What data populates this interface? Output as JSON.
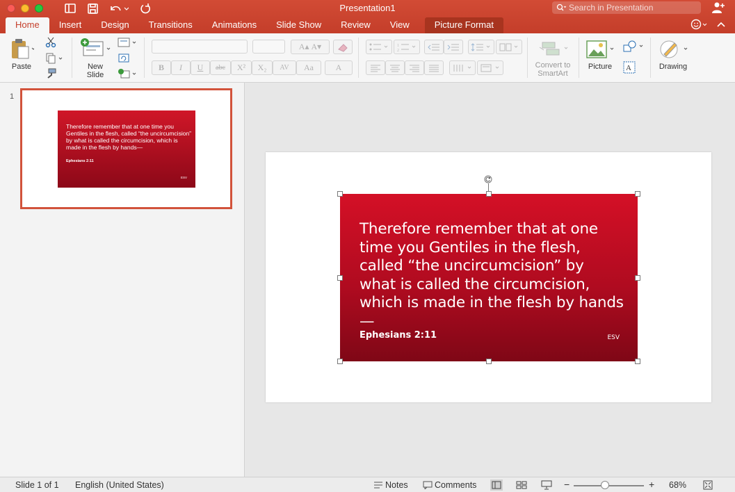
{
  "window": {
    "title": "Presentation1"
  },
  "search": {
    "placeholder": "Search in Presentation"
  },
  "tabs": [
    {
      "label": "Home"
    },
    {
      "label": "Insert"
    },
    {
      "label": "Design"
    },
    {
      "label": "Transitions"
    },
    {
      "label": "Animations"
    },
    {
      "label": "Slide Show"
    },
    {
      "label": "Review"
    },
    {
      "label": "View"
    },
    {
      "label": "Picture Format"
    }
  ],
  "ribbon": {
    "paste_label": "Paste",
    "new_slide_label_line1": "New",
    "new_slide_label_line2": "Slide",
    "convert_label_line1": "Convert to",
    "convert_label_line2": "SmartArt",
    "picture_label": "Picture",
    "drawing_label": "Drawing",
    "fmt": {
      "bold": "B",
      "italic": "I",
      "underline": "U",
      "strike": "abc",
      "superscript": "X²",
      "subscript": "X₂",
      "spacing": "AV",
      "case": "Aa",
      "fontcolor": "A",
      "grow": "A▴",
      "shrink": "A▾"
    }
  },
  "thumbnail": {
    "slide_number": "1"
  },
  "slide_content": {
    "quote": "Therefore remember that at one time you Gentiles in the flesh, called “the uncircumcision” by what is called the circumcision, which is made in the flesh by hands—",
    "reference": "Ephesians 2:11",
    "version": "ESV"
  },
  "status": {
    "slide_info": "Slide 1 of 1",
    "language": "English (United States)",
    "notes": "Notes",
    "comments": "Comments",
    "zoom_minus": "−",
    "zoom_plus": "+",
    "zoom_level": "68%",
    "zoom_fraction": 0.45
  }
}
